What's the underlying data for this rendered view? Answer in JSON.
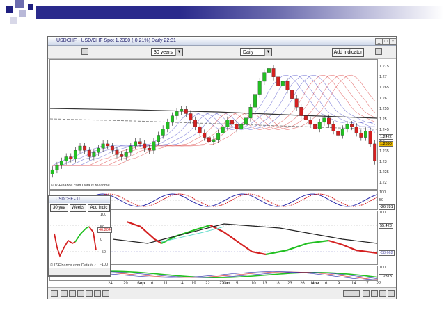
{
  "window": {
    "title": "USDCHF - USD/CHF Spot    1.2390 (-0.21%)    Daily  22:31",
    "period_select": "30 years",
    "interval_select": "Daily",
    "add_indicator_label": "Add indicator",
    "min_btn": "_",
    "max_btn": "□",
    "close_btn": "x"
  },
  "price_axis": [
    "1.275",
    "1.27",
    "1.265",
    "1.26",
    "1.255",
    "1.25",
    "1.245",
    "1.24",
    "1.235",
    "1.23",
    "1.225",
    "1.22"
  ],
  "price_tags": {
    "upper": "1.2422",
    "current": "1.2390"
  },
  "watermark": "© IT-Finance.com  Data is real time",
  "osc1": {
    "top": "100",
    "mid": "50",
    "bottom": "-100",
    "value": "-26.781"
  },
  "osc2": {
    "top": "100",
    "value": "55.428",
    "low": "-58.662"
  },
  "osc3": {
    "top": "100",
    "value": "1.2378"
  },
  "date_axis": [
    "24",
    "29",
    "Sep",
    "6",
    "11",
    "14",
    "19",
    "22",
    "27",
    "Oct",
    "5",
    "10",
    "13",
    "18",
    "23",
    "26",
    "Nov",
    "6",
    "9",
    "14",
    "17",
    "22"
  ],
  "mini_window": {
    "title": "USDCHF - U...",
    "period": "30 yea",
    "interval": "Weeks",
    "add": "Add indic",
    "scale": [
      "100",
      "50",
      "0",
      "-50",
      "-100"
    ],
    "value": "46.204",
    "watermark": "© IT-Finance.com  Data is r",
    "months": [
      "May",
      "Aug",
      "Nov"
    ]
  },
  "colors": {
    "bull": "#22c022",
    "bear": "#d42020",
    "titlebar": "#1a1a6a"
  }
}
